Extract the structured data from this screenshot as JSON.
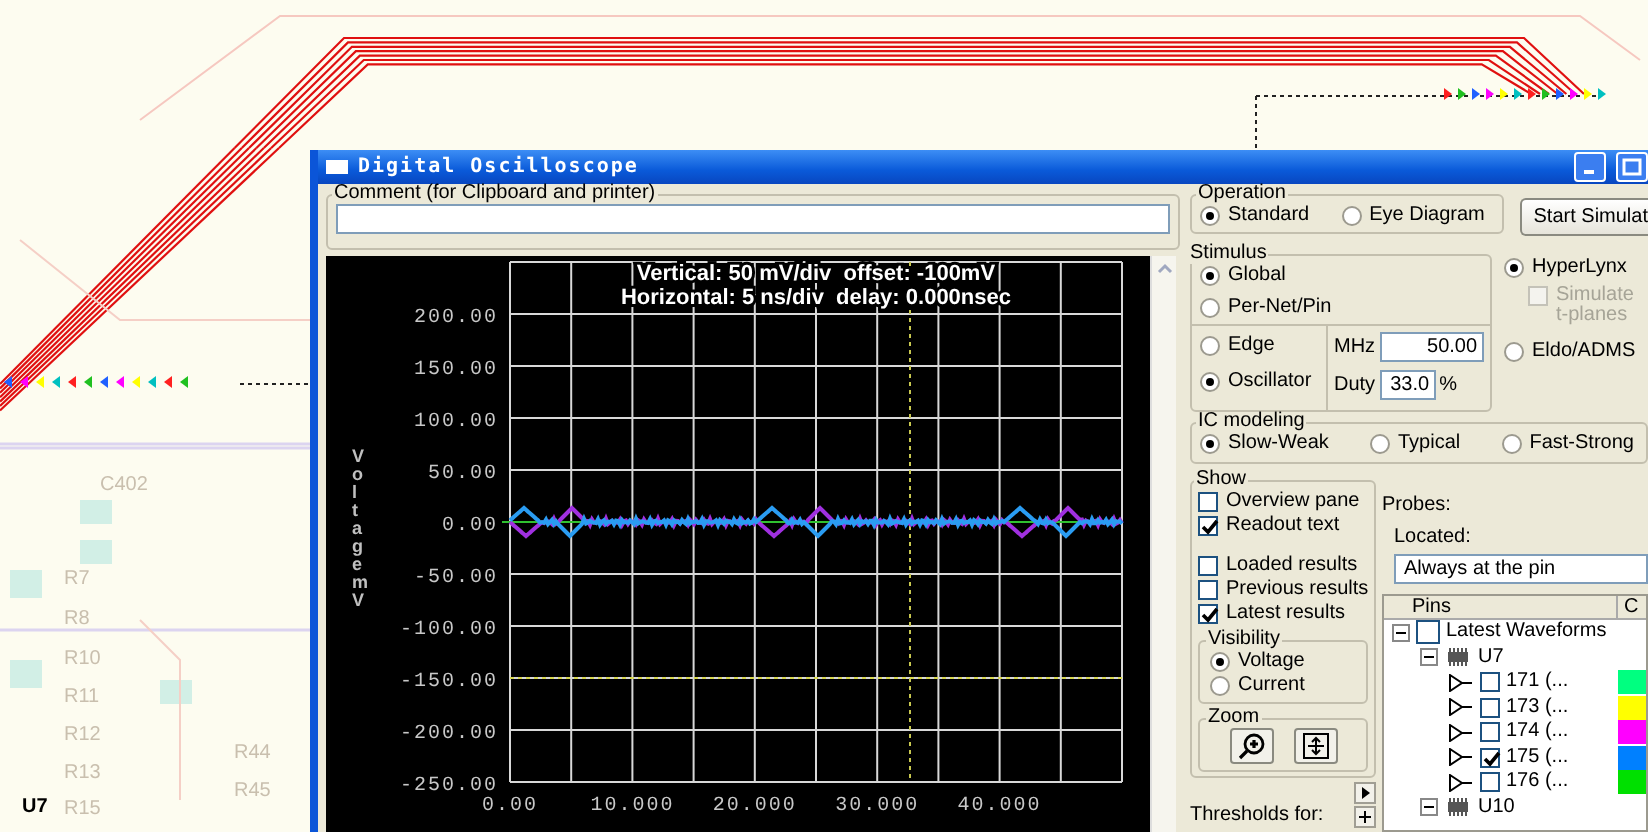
{
  "desktop": {
    "component_labels": [
      "C402",
      "R7",
      "R8",
      "R10",
      "R11",
      "R12",
      "R13",
      "R15",
      "R44",
      "R45"
    ],
    "part_label": "U7"
  },
  "window": {
    "title": "Digital Oscilloscope"
  },
  "comment": {
    "label": "Comment (for Clipboard and printer)"
  },
  "scope": {
    "header_lines": [
      "Vertical: 50 mV/div  offset: -100mV",
      "Horizontal: 5 ns/div  delay: 0.000nsec"
    ],
    "y_axis_title": "Voltage mV",
    "y_ticks": [
      "200.00",
      "150.00",
      "100.00",
      "50.00",
      "0.00",
      "-50.00",
      "-100.00",
      "-150.00",
      "-200.00",
      "-250.00"
    ],
    "x_ticks": [
      "0.00",
      "10.000",
      "20.000",
      "30.000",
      "40.000"
    ]
  },
  "operation": {
    "label": "Operation",
    "options": [
      {
        "label": "Standard",
        "selected": true
      },
      {
        "label": "Eye Diagram",
        "selected": false
      }
    ]
  },
  "start_button": "Start Simulat",
  "stimulus": {
    "label": "Stimulus",
    "scope_options": [
      {
        "label": "Global",
        "selected": true
      },
      {
        "label": "Per-Net/Pin",
        "selected": false
      }
    ],
    "type_options": [
      {
        "label": "Edge",
        "selected": false
      },
      {
        "label": "Oscillator",
        "selected": true
      }
    ],
    "mhz": {
      "label": "MHz",
      "value": "50.00"
    },
    "duty": {
      "label": "Duty",
      "value": "33.0",
      "unit": "%"
    }
  },
  "simulator": {
    "options": [
      {
        "label": "HyperLynx",
        "selected": true
      },
      {
        "label": "Eldo/ADMS",
        "selected": false
      }
    ],
    "simulate_planes": {
      "label": "Simulate t-planes",
      "checked": false,
      "disabled": true
    }
  },
  "ic_modeling": {
    "label": "IC modeling",
    "options": [
      {
        "label": "Slow-Weak",
        "selected": true
      },
      {
        "label": "Typical",
        "selected": false
      },
      {
        "label": "Fast-Strong",
        "selected": false
      }
    ]
  },
  "show": {
    "label": "Show",
    "checkboxes_top": [
      {
        "label": "Overview pane",
        "checked": false
      },
      {
        "label": "Readout text",
        "checked": true
      }
    ],
    "checkboxes_bottom": [
      {
        "label": "Loaded results",
        "checked": false
      },
      {
        "label": "Previous results",
        "checked": false
      },
      {
        "label": "Latest results",
        "checked": true
      }
    ],
    "visibility": {
      "label": "Visibility",
      "options": [
        {
          "label": "Voltage",
          "selected": true
        },
        {
          "label": "Current",
          "selected": false
        }
      ]
    },
    "zoom": {
      "label": "Zoom"
    },
    "thresholds_label": "Thresholds for:"
  },
  "probes": {
    "label": "Probes:",
    "located_label": "Located:",
    "located_value": "Always at the pin"
  },
  "pins": {
    "columns": [
      "Pins",
      "C"
    ],
    "tree": [
      {
        "kind": "group",
        "label": "Latest Waveforms",
        "checked": false,
        "expanded": true,
        "children": [
          {
            "kind": "component",
            "label": "U7",
            "expanded": true,
            "children": [
              {
                "kind": "pin",
                "label": "171 (...",
                "checked": false,
                "color": "#00ff80"
              },
              {
                "kind": "pin",
                "label": "173 (...",
                "checked": false,
                "color": "#ffff00"
              },
              {
                "kind": "pin",
                "label": "174 (...",
                "checked": false,
                "color": "#ff00ff"
              },
              {
                "kind": "pin",
                "label": "175 (...",
                "checked": true,
                "color": "#0080ff"
              },
              {
                "kind": "pin",
                "label": "176 (...",
                "checked": false,
                "color": "#00e000"
              }
            ]
          },
          {
            "kind": "component",
            "label": "U10",
            "expanded": true
          }
        ]
      }
    ]
  }
}
